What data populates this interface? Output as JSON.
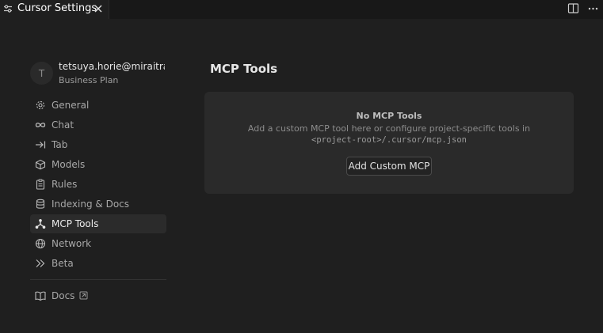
{
  "tab": {
    "title": "Cursor Settings"
  },
  "user": {
    "initial": "T",
    "email": "tetsuya.horie@miraitra...",
    "plan": "Business Plan"
  },
  "nav": {
    "items": [
      {
        "label": "General",
        "icon": "gear-icon"
      },
      {
        "label": "Chat",
        "icon": "infinity-icon"
      },
      {
        "label": "Tab",
        "icon": "arrow-right-bar-icon"
      },
      {
        "label": "Models",
        "icon": "cube-icon"
      },
      {
        "label": "Rules",
        "icon": "clipboard-icon"
      },
      {
        "label": "Indexing & Docs",
        "icon": "database-icon"
      },
      {
        "label": "MCP Tools",
        "icon": "mcp-nodes-icon",
        "active": true
      },
      {
        "label": "Network",
        "icon": "globe-icon"
      },
      {
        "label": "Beta",
        "icon": "double-chevron-icon"
      }
    ],
    "docs": {
      "label": "Docs",
      "icon": "book-icon"
    }
  },
  "main": {
    "title": "MCP Tools",
    "empty_title": "No MCP Tools",
    "empty_desc": "Add a custom MCP tool here or configure project-specific tools in",
    "empty_path": "<project-root>/.cursor/mcp.json",
    "add_button": "Add Custom MCP"
  },
  "colors": {
    "background": "#1f1f1f",
    "panel": "#2a2a2a",
    "active_nav": "#2b2b2b"
  }
}
